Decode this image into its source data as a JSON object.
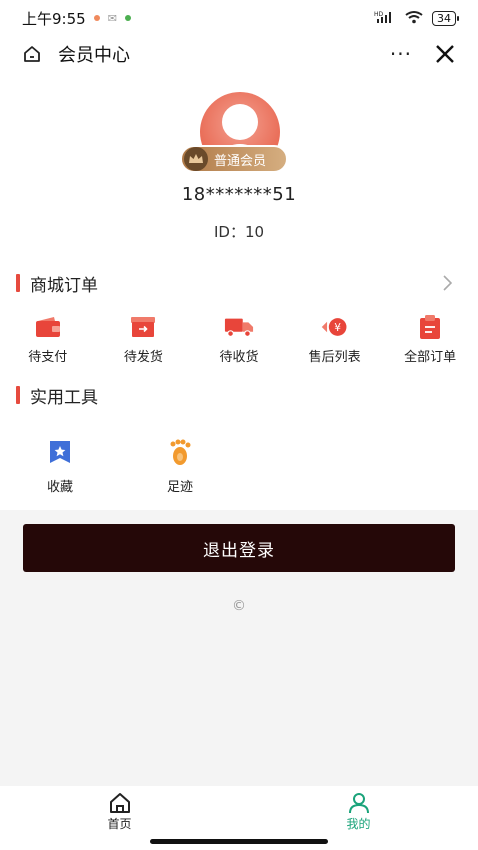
{
  "status_bar": {
    "time": "上午9:55",
    "signal": "HD",
    "battery": "34"
  },
  "header": {
    "title": "会员中心",
    "more_label": "···"
  },
  "profile": {
    "member_level": "普通会员",
    "phone": "18*******51",
    "id_label": "ID：10"
  },
  "orders": {
    "title": "商城订单",
    "items": [
      {
        "label": "待支付",
        "icon": "wallet-icon"
      },
      {
        "label": "待发货",
        "icon": "package-icon"
      },
      {
        "label": "待收货",
        "icon": "truck-icon"
      },
      {
        "label": "售后列表",
        "icon": "refund-icon"
      },
      {
        "label": "全部订单",
        "icon": "clipboard-icon"
      }
    ]
  },
  "tools": {
    "title": "实用工具",
    "items": [
      {
        "label": "收藏",
        "icon": "bookmark-star-icon"
      },
      {
        "label": "足迹",
        "icon": "footprint-icon"
      }
    ]
  },
  "logout_label": "退出登录",
  "copyright": "©",
  "tabs": [
    {
      "label": "首页",
      "icon": "home-icon"
    },
    {
      "label": "我的",
      "icon": "person-icon"
    }
  ],
  "colors": {
    "accent": "#e64a3e",
    "active_tab": "#1aa37a",
    "logout_bg": "#250808",
    "tools_blue": "#3f6fd8",
    "tools_orange": "#f29a2e"
  }
}
